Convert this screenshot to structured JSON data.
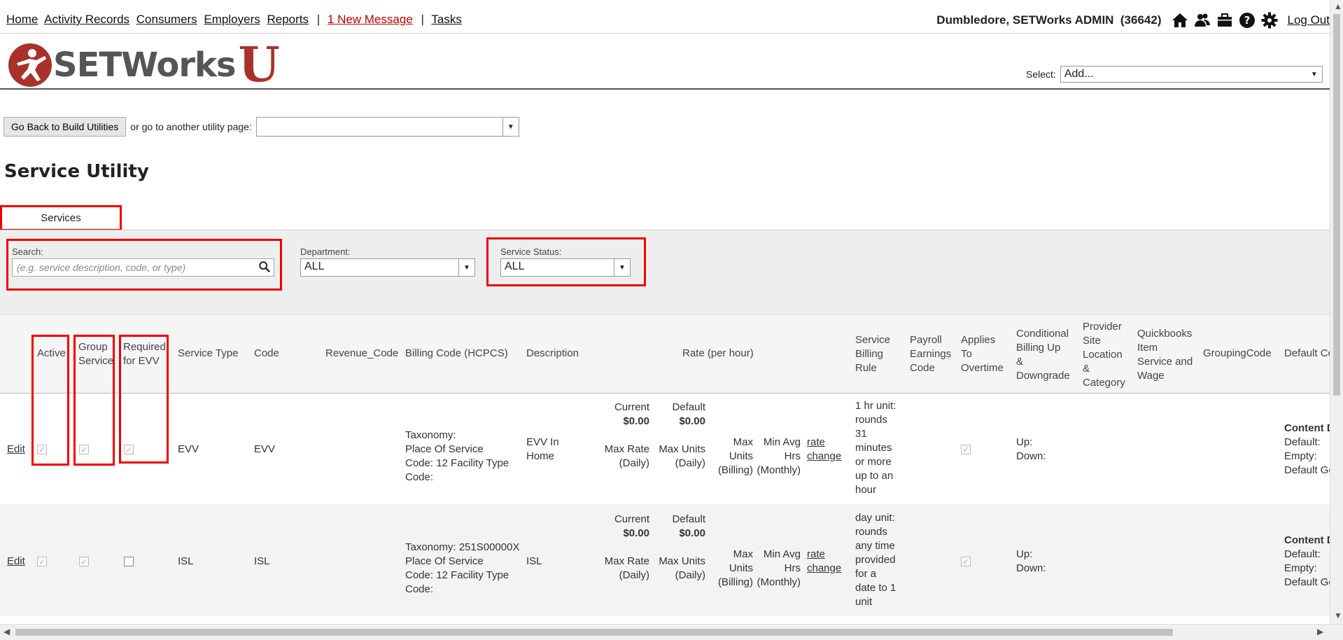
{
  "nav": {
    "home": "Home",
    "activity": "Activity Records",
    "consumers": "Consumers",
    "employers": "Employers",
    "reports": "Reports",
    "sep": "|",
    "message": "1 New Message",
    "tasks": "Tasks",
    "user": "Dumbledore, SETWorks ADMIN",
    "user_id": "(36642)",
    "logout": "Log Out"
  },
  "header": {
    "logo_text": "SETWorks",
    "logo_u": "U",
    "select_label": "Select:",
    "select_value": "Add..."
  },
  "utility": {
    "back_button": "Go Back to Build Utilities",
    "goto_text": "or go to another utility page:",
    "goto_value": ""
  },
  "page_title": "Service Utility",
  "tab_services": "Services",
  "filters": {
    "search_label": "Search:",
    "search_placeholder": "(e.g. service description, code, or type)",
    "department_label": "Department:",
    "department_value": "ALL",
    "status_label": "Service Status:",
    "status_value": "ALL"
  },
  "table": {
    "headers": {
      "active": "Active",
      "group1": "Group",
      "group2": "Service",
      "req1": "Required",
      "req2": "for EVV",
      "service_type": "Service Type",
      "code": "Code",
      "revenue_code": "Revenue_Code",
      "billing_code": "Billing Code (HCPCS)",
      "description": "Description",
      "rate": "Rate (per hour)",
      "sbr1": "Service",
      "sbr2": "Billing",
      "sbr3": "Rule",
      "pay1": "Payroll",
      "pay2": "Earnings",
      "pay3": "Code",
      "ot1": "Applies",
      "ot2": "To",
      "ot3": "Overtime",
      "cb1": "Conditional",
      "cb2": "Billing Up",
      "cb3": "&",
      "cb4": "Downgrade",
      "ps1": "Provider",
      "ps2": "Site",
      "ps3": "Location",
      "ps4": "&",
      "ps5": "Category",
      "qb1": "Quickbooks",
      "qb2": "Item",
      "qb3": "Service and",
      "qb4": "Wage",
      "grouping": "GroupingCode",
      "default_c": "Default Co"
    },
    "rows": [
      {
        "edit": "Edit",
        "service_type": "EVV",
        "code": "EVV",
        "tax1": "Taxonomy:",
        "tax2": "Place Of Service",
        "tax3": "Code: 12 Facility Type",
        "tax4": "Code:",
        "desc1": "EVV In",
        "desc2": "Home",
        "current_label": "Current",
        "current_value": "$0.00",
        "default_label": "Default",
        "default_value": "$0.00",
        "maxrate1": "Max Rate",
        "maxrate2": "(Daily)",
        "maxunits1": "Max Units",
        "maxunits2": "(Daily)",
        "mub1": "Max",
        "mub2": "Units",
        "mub3": "(Billing)",
        "mah1": "Min Avg",
        "mah2": "Hrs",
        "mah3": "(Monthly)",
        "rc1": "rate",
        "rc2": "change",
        "rule": [
          "1 hr unit:",
          "rounds",
          "31",
          "minutes",
          "or more",
          "up to an",
          "hour"
        ],
        "up": "Up:",
        "down": "Down:",
        "content_title": "Content D",
        "c_default": "Default:",
        "c_empty": "Empty:",
        "c_defgo": "Default Go"
      },
      {
        "edit": "Edit",
        "service_type": "ISL",
        "code": "ISL",
        "tax1": "Taxonomy: 251S00000X",
        "tax2": "Place Of Service",
        "tax3": "Code: 12 Facility Type",
        "tax4": "Code:",
        "desc1": "ISL",
        "desc2": "",
        "current_label": "Current",
        "current_value": "$0.00",
        "default_label": "Default",
        "default_value": "$0.00",
        "maxrate1": "Max Rate",
        "maxrate2": "(Daily)",
        "maxunits1": "Max Units",
        "maxunits2": "(Daily)",
        "mub1": "Max",
        "mub2": "Units",
        "mub3": "(Billing)",
        "mah1": "Min Avg",
        "mah2": "Hrs",
        "mah3": "(Monthly)",
        "rc1": "rate",
        "rc2": "change",
        "rule": [
          "day unit:",
          "rounds",
          "any time",
          "provided",
          "for a",
          "date to 1",
          "unit"
        ],
        "up": "Up:",
        "down": "Down:",
        "content_title": "Content D",
        "c_default": "Default:",
        "c_empty": "Empty:",
        "c_defgo": "Default Go"
      }
    ]
  }
}
